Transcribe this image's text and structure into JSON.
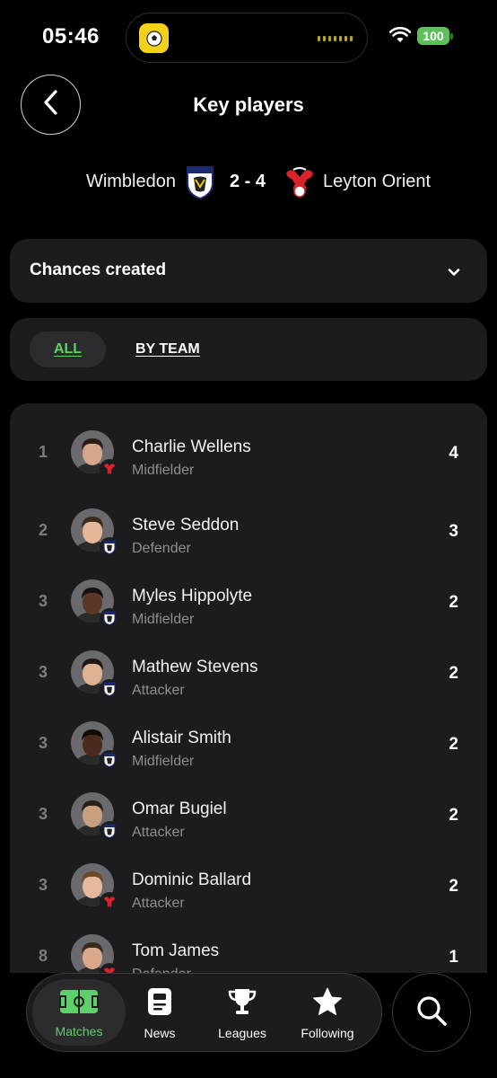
{
  "status_bar": {
    "time": "05:46",
    "battery": "100"
  },
  "header": {
    "title": "Key players"
  },
  "match": {
    "home_team": "Wimbledon",
    "score": "2 - 4",
    "away_team": "Leyton Orient"
  },
  "stat_selector": {
    "selected": "Chances created"
  },
  "filter_tabs": {
    "all_label": "ALL",
    "by_team_label": "BY TEAM",
    "active": "ALL"
  },
  "players": [
    {
      "rank": "1",
      "name": "Charlie Wellens",
      "position": "Midfielder",
      "value": "4",
      "team": "Leyton Orient"
    },
    {
      "rank": "2",
      "name": "Steve Seddon",
      "position": "Defender",
      "value": "3",
      "team": "Wimbledon"
    },
    {
      "rank": "3",
      "name": "Myles Hippolyte",
      "position": "Midfielder",
      "value": "2",
      "team": "Wimbledon"
    },
    {
      "rank": "3",
      "name": "Mathew Stevens",
      "position": "Attacker",
      "value": "2",
      "team": "Wimbledon"
    },
    {
      "rank": "3",
      "name": "Alistair Smith",
      "position": "Midfielder",
      "value": "2",
      "team": "Wimbledon"
    },
    {
      "rank": "3",
      "name": "Omar Bugiel",
      "position": "Attacker",
      "value": "2",
      "team": "Wimbledon"
    },
    {
      "rank": "3",
      "name": "Dominic Ballard",
      "position": "Attacker",
      "value": "2",
      "team": "Leyton Orient"
    },
    {
      "rank": "8",
      "name": "Tom James",
      "position": "Defender",
      "value": "1",
      "team": "Leyton Orient"
    }
  ],
  "bottom_nav": {
    "items": [
      {
        "label": "Matches",
        "icon": "pitch-icon",
        "active": true
      },
      {
        "label": "News",
        "icon": "news-icon",
        "active": false
      },
      {
        "label": "Leagues",
        "icon": "trophy-icon",
        "active": false
      },
      {
        "label": "Following",
        "icon": "star-icon",
        "active": false
      }
    ],
    "search_icon": "search-icon"
  },
  "colors": {
    "accent": "#5dd06a",
    "card": "#1c1c1e",
    "background": "#000000",
    "battery": "#5ec05a"
  }
}
